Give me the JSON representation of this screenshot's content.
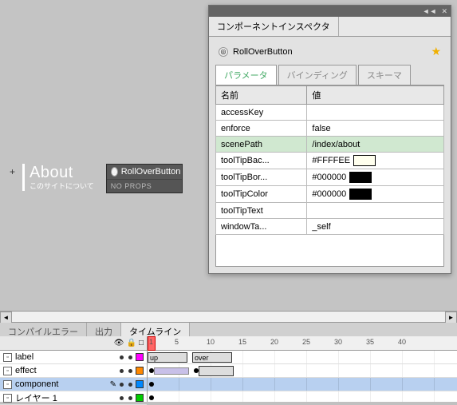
{
  "stage": {
    "about_title": "About",
    "about_sub": "このサイトについて",
    "instance_label": "RollOverButton",
    "instance_props": "NO PROPS"
  },
  "panel": {
    "title": "コンポーネントインスペクタ",
    "component_name": "RollOverButton",
    "tabs": {
      "params": "パラメータ",
      "bindings": "バインディング",
      "schema": "スキーマ"
    },
    "col_name": "名前",
    "col_value": "値",
    "rows": [
      {
        "name": "accessKey",
        "value": ""
      },
      {
        "name": "enforce",
        "value": "false"
      },
      {
        "name": "scenePath",
        "value": "/index/about",
        "sel": true
      },
      {
        "name": "toolTipBac...",
        "value": "#FFFFEE",
        "color": "#FFFFEE"
      },
      {
        "name": "toolTipBor...",
        "value": "#000000",
        "color": "#000000"
      },
      {
        "name": "toolTipColor",
        "value": "#000000",
        "color": "#000000"
      },
      {
        "name": "toolTipText",
        "value": ""
      },
      {
        "name": "windowTa...",
        "value": "_self"
      }
    ]
  },
  "bottom_tabs": {
    "compile": "コンパイルエラー",
    "output": "出力",
    "timeline": "タイムライン"
  },
  "timeline": {
    "ruler": [
      "1",
      "5",
      "10",
      "15",
      "20",
      "25",
      "30",
      "35",
      "40"
    ],
    "layers": [
      {
        "name": "label",
        "color": "#f0f"
      },
      {
        "name": "effect",
        "color": "#f80"
      },
      {
        "name": "component",
        "color": "#08f",
        "sel": true
      },
      {
        "name": "レイヤー 1",
        "color": "#0c0"
      }
    ],
    "frame_labels": {
      "up": "up",
      "over": "over"
    }
  }
}
